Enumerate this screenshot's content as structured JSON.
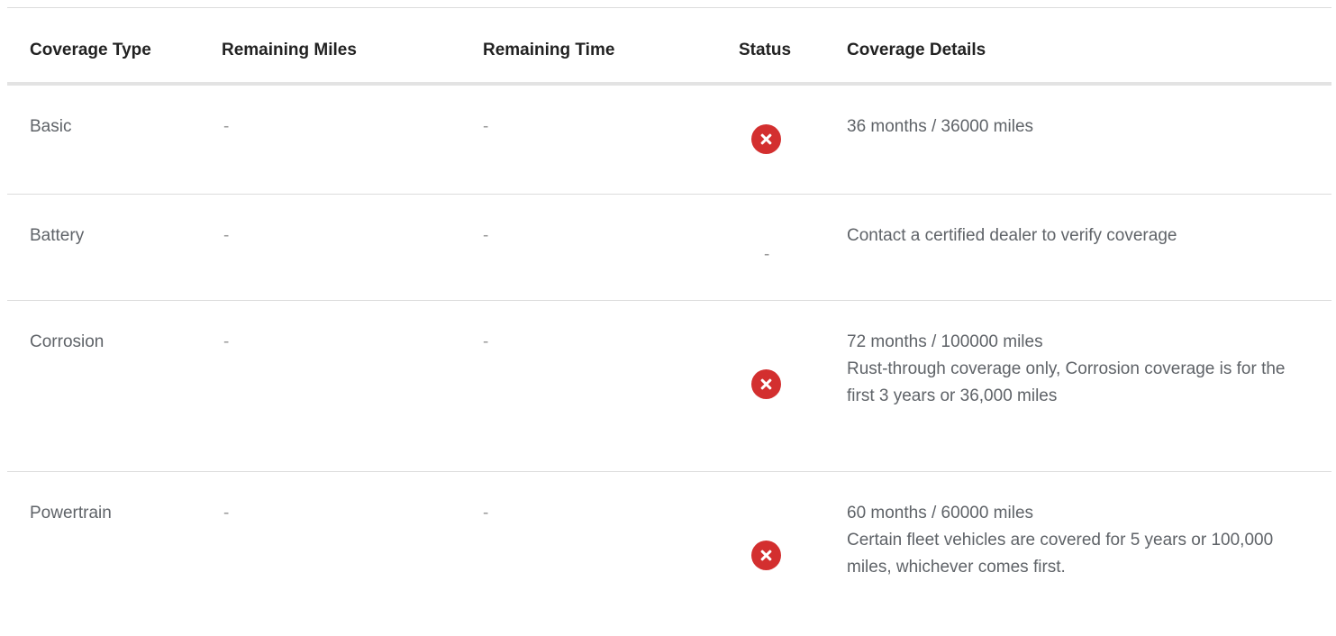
{
  "table": {
    "headers": {
      "coverage_type": "Coverage Type",
      "remaining_miles": "Remaining Miles",
      "remaining_time": "Remaining Time",
      "status": "Status",
      "coverage_details": "Coverage Details"
    },
    "rows": [
      {
        "coverage_type": "Basic",
        "remaining_miles": "-",
        "remaining_time": "-",
        "status_icon": "error-x-circle-icon",
        "status_text": "",
        "details_line1": "36 months / 36000 miles",
        "details_line2": ""
      },
      {
        "coverage_type": "Battery",
        "remaining_miles": "-",
        "remaining_time": "-",
        "status_icon": "",
        "status_text": "-",
        "details_line1": "Contact a certified dealer to verify coverage",
        "details_line2": ""
      },
      {
        "coverage_type": "Corrosion",
        "remaining_miles": "-",
        "remaining_time": "-",
        "status_icon": "error-x-circle-icon",
        "status_text": "",
        "details_line1": "72 months / 100000 miles",
        "details_line2": "Rust-through coverage only, Corrosion coverage is for the first 3 years or 36,000 miles"
      },
      {
        "coverage_type": "Powertrain",
        "remaining_miles": "-",
        "remaining_time": "-",
        "status_icon": "error-x-circle-icon",
        "status_text": "",
        "details_line1": "60 months / 60000 miles",
        "details_line2": "Certain fleet vehicles are covered for 5 years or 100,000 miles, whichever comes first."
      }
    ]
  },
  "colors": {
    "status_error": "#d32f2f",
    "header_text": "#222222",
    "body_text": "#5f6368"
  }
}
